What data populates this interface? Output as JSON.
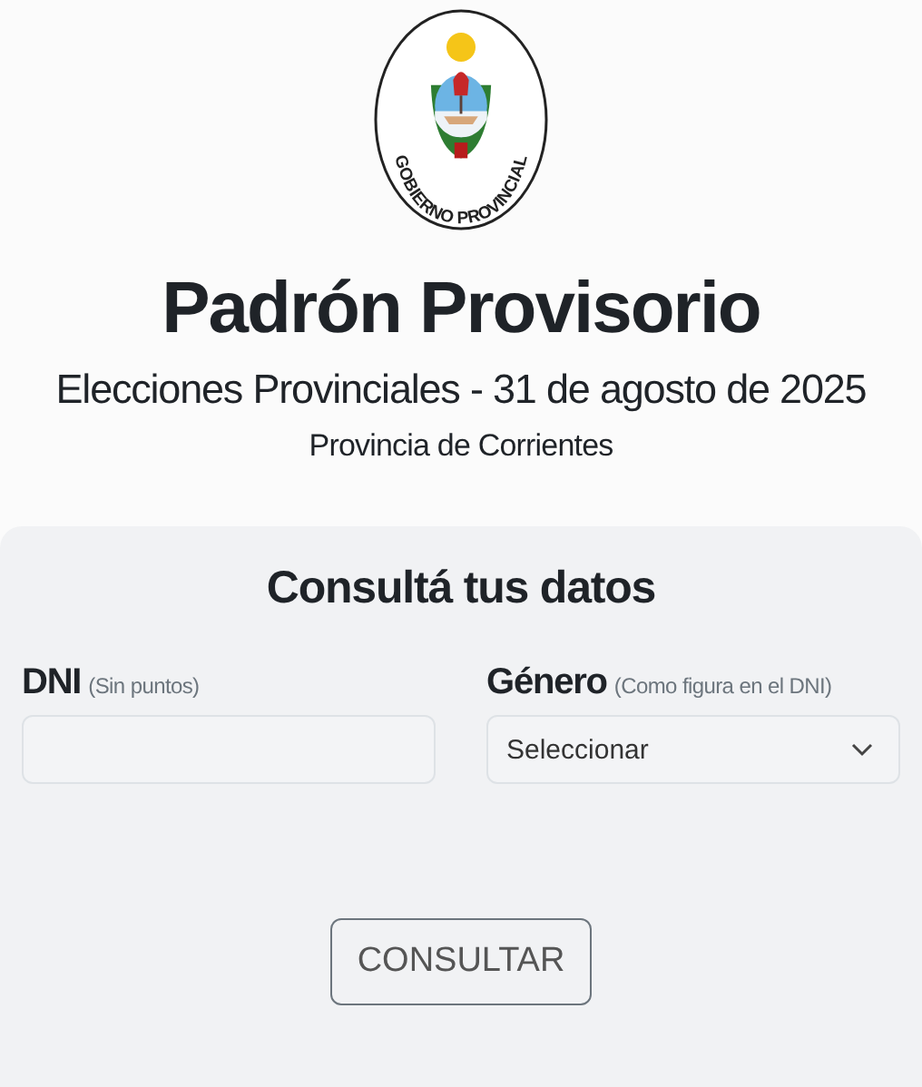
{
  "logo": {
    "text": "GOBIERNO PROVINCIAL"
  },
  "header": {
    "title": "Padrón Provisorio",
    "subtitle": "Elecciones Provinciales - 31 de agosto de 2025",
    "province": "Provincia de Corrientes"
  },
  "form": {
    "title": "Consultá tus datos",
    "fields": [
      {
        "kind": "text",
        "label": "DNI",
        "hint": "(Sin puntos)"
      },
      {
        "kind": "select",
        "label": "Género",
        "hint": "(Como figura en el DNI)",
        "value": "Seleccionar"
      }
    ],
    "button": "CONSULTAR"
  }
}
